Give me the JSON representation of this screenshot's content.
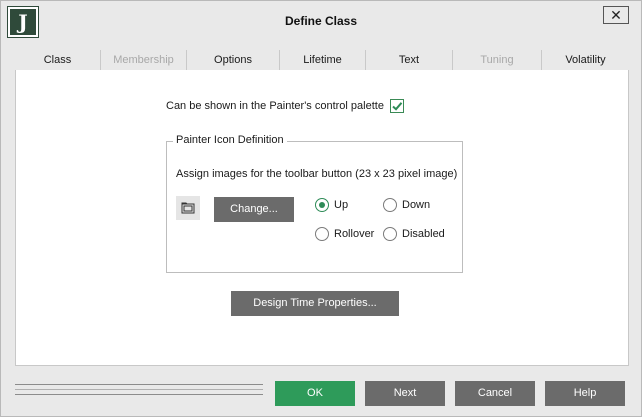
{
  "window": {
    "title": "Define Class",
    "logo_letter": "J",
    "close_glyph": "✕"
  },
  "tabs": [
    {
      "label": "Class",
      "enabled": true,
      "active": false
    },
    {
      "label": "Membership",
      "enabled": false,
      "active": false
    },
    {
      "label": "Options",
      "enabled": true,
      "active": true
    },
    {
      "label": "Lifetime",
      "enabled": true,
      "active": false
    },
    {
      "label": "Text",
      "enabled": true,
      "active": false
    },
    {
      "label": "Tuning",
      "enabled": false,
      "active": false
    },
    {
      "label": "Volatility",
      "enabled": true,
      "active": false
    }
  ],
  "options": {
    "palette_label": "Can be shown in the Painter's control palette",
    "palette_checked": true,
    "group_title": "Painter Icon Definition",
    "assign_text": "Assign images for the toolbar button (23 x 23 pixel image)",
    "change_label": "Change...",
    "radios": {
      "up": {
        "label": "Up",
        "checked": true
      },
      "down": {
        "label": "Down",
        "checked": false
      },
      "rollover": {
        "label": "Rollover",
        "checked": false
      },
      "disabled": {
        "label": "Disabled",
        "checked": false
      }
    },
    "design_label": "Design Time Properties..."
  },
  "footer": {
    "ok_label": "OK",
    "next_label": "Next",
    "cancel_label": "Cancel",
    "help_label": "Help"
  },
  "colors": {
    "accent_green": "#2e9b5a",
    "button_gray": "#6b6b6b",
    "logo_bg": "#2f4a3a"
  }
}
